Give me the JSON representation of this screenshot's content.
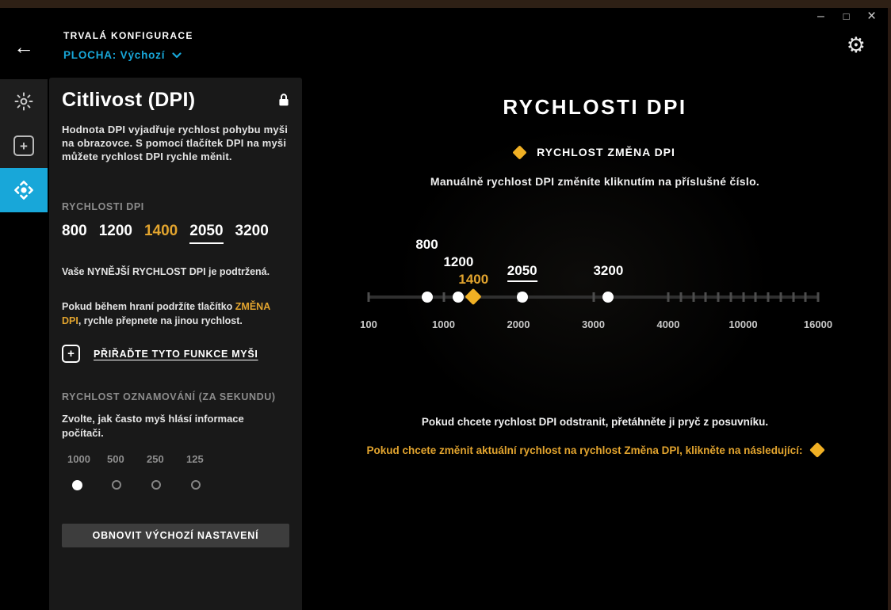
{
  "titlebar": {
    "minimize": "–",
    "maximize": "□",
    "close": "×"
  },
  "header": {
    "back": "←",
    "eyebrow": "TRVALÁ KONFIGURACE",
    "profile": "PLOCHA: Výchozí"
  },
  "sidebar": {
    "items": [
      {
        "id": "lighting",
        "icon": "sun-icon",
        "active": false
      },
      {
        "id": "assignments",
        "icon": "plus-square-icon",
        "active": false
      },
      {
        "id": "dpi-sensitivity",
        "icon": "move-icon",
        "active": true
      }
    ]
  },
  "panel": {
    "title": "Citlivost (DPI)",
    "plus_glyph": "+",
    "description": "Hodnota DPI vyjadřuje rychlost pohybu myši na obrazovce. S pomocí tlačítek DPI na myši můžete rychlost DPI rychle měnit.",
    "dpi_section_label": "RYCHLOSTI DPI",
    "dpi_values": [
      {
        "value": "800",
        "style": "normal"
      },
      {
        "value": "1200",
        "style": "normal"
      },
      {
        "value": "1400",
        "style": "accent"
      },
      {
        "value": "2050",
        "style": "current"
      },
      {
        "value": "3200",
        "style": "normal"
      }
    ],
    "note_current": "Vaše NYNĚJŠÍ RYCHLOST DPI je podtržená.",
    "note_shift_pre": "Pokud během hraní podržíte tlačítko ",
    "note_shift_accent": "ZMĚNA DPI",
    "note_shift_post": ", rychle přepnete na jinou rychlost.",
    "assign_link": "PŘIŘAĎTE TYTO FUNKCE MYŠI",
    "report_rate_label": "RYCHLOST OZNAMOVÁNÍ (ZA SEKUNDU)",
    "report_rate_help": "Zvolte, jak často myš hlásí informace počítači.",
    "report_rates": [
      {
        "label": "1000",
        "selected": true
      },
      {
        "label": "500",
        "selected": false
      },
      {
        "label": "250",
        "selected": false
      },
      {
        "label": "125",
        "selected": false
      }
    ],
    "restore_button": "OBNOVIT VÝCHOZÍ NASTAVENÍ"
  },
  "main": {
    "title": "RYCHLOSTI DPI",
    "legend_label": "RYCHLOST ZMĚNA DPI",
    "subtitle": "Manuálně rychlost DPI změníte kliknutím na příslušné číslo.",
    "slider": {
      "axis_labels": [
        100,
        1000,
        2000,
        3000,
        4000,
        10000,
        16000
      ],
      "tick_values": [
        100,
        1000,
        2000,
        3000,
        4000,
        5000,
        6000,
        7000,
        8000,
        9000,
        10000,
        11000,
        12000,
        13000,
        14000,
        15000,
        16000
      ],
      "markers": [
        {
          "value": 800,
          "label": "800",
          "type": "dot",
          "level": 0,
          "accent": false,
          "underline": false
        },
        {
          "value": 1200,
          "label": "1200",
          "type": "dot",
          "level": 1,
          "accent": false,
          "underline": false
        },
        {
          "value": 1400,
          "label": "1400",
          "type": "diamond",
          "level": 2,
          "accent": true,
          "underline": false
        },
        {
          "value": 2050,
          "label": "2050",
          "type": "dot",
          "level": 1.5,
          "accent": false,
          "underline": true
        },
        {
          "value": 3200,
          "label": "3200",
          "type": "dot",
          "level": 1.5,
          "accent": false,
          "underline": false
        }
      ]
    },
    "hint_remove": "Pokud chcete rychlost DPI odstranit, přetáhněte ji pryč z posuvníku.",
    "hint_shift": "Pokud chcete změnit aktuální rychlost na rychlost Změna DPI, klikněte na následující:"
  },
  "colors": {
    "accent_blue": "#18a7d9",
    "accent_gold": "#f0b024",
    "accent_gold_text": "#e2a42e"
  }
}
